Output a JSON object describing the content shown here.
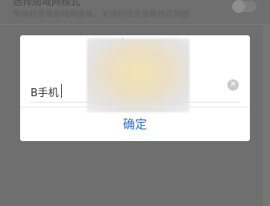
{
  "background": {
    "setting_title": "选择局域网模式",
    "setting_subtitle": "传输时使用局域网连接，关闭则优先使用热点网络"
  },
  "dialog": {
    "input_value": "B手机",
    "confirm_label": "确定"
  },
  "colors": {
    "overlay": "#6f6f6f",
    "dialog_bg": "#ffffff",
    "accent": "#2a6fd6"
  },
  "icons": {
    "clear": "clear-icon"
  }
}
